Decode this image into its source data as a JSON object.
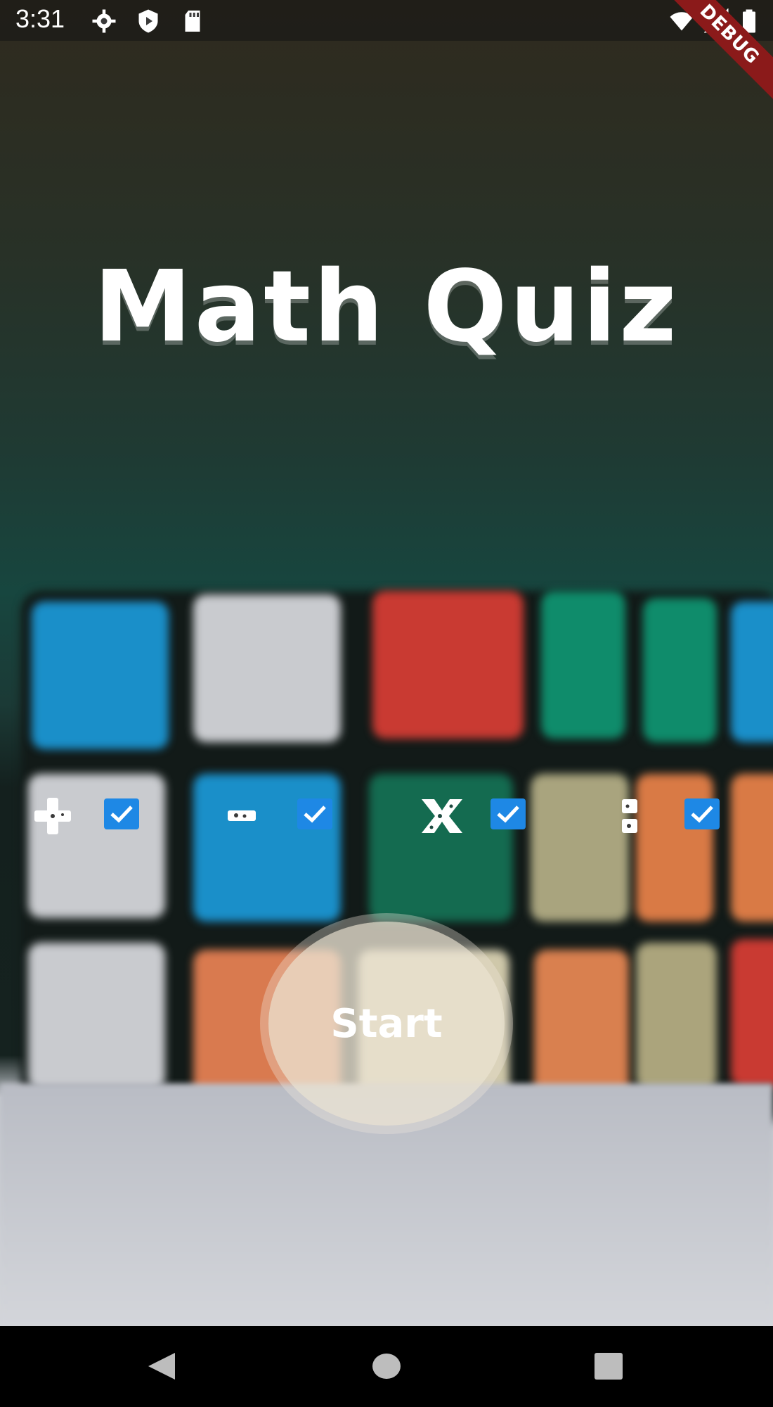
{
  "status_bar": {
    "time": "3:31",
    "icons": [
      "settings-icon",
      "play-protect-icon",
      "sd-card-icon",
      "wifi-icon",
      "signal-icon",
      "battery-icon"
    ],
    "debug_banner": "DEBUG"
  },
  "title": "Math Quiz",
  "operations": [
    {
      "name": "addition",
      "symbol": "+",
      "checked": true
    },
    {
      "name": "subtraction",
      "symbol": "-",
      "checked": true
    },
    {
      "name": "multiplication",
      "symbol": "x",
      "checked": true
    },
    {
      "name": "division",
      "symbol": ":",
      "checked": true
    }
  ],
  "start_button": {
    "label": "Start"
  },
  "nav_bar": {
    "icons": [
      "back-icon",
      "home-icon",
      "recents-icon"
    ]
  },
  "colors": {
    "checkbox": "#1e88e5",
    "debug_banner": "#8b1a1a"
  }
}
